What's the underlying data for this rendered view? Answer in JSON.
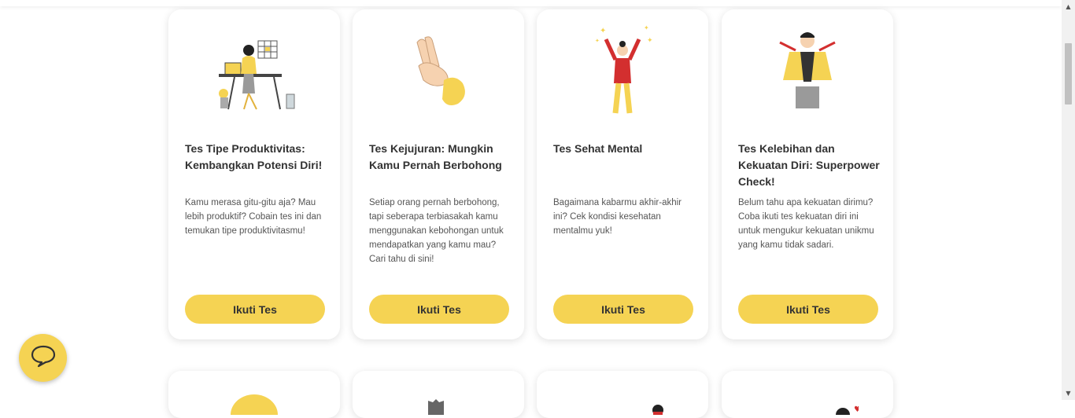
{
  "cards": [
    {
      "title": "Tes Tipe Produktivitas: Kembangkan Potensi Diri!",
      "description": "Kamu merasa gitu-gitu aja? Mau lebih produktif? Cobain tes ini dan temukan tipe produktivitasmu!",
      "button_label": "Ikuti Tes",
      "illustration": "person-at-desk-illustration"
    },
    {
      "title": "Tes Kejujuran: Mungkin Kamu Pernah Berbohong",
      "description": "Setiap orang pernah berbohong, tapi seberapa terbiasakah kamu menggunakan kebohongan untuk mendapatkan yang kamu mau? Cari tahu di sini!",
      "button_label": "Ikuti Tes",
      "illustration": "crossed-fingers-illustration"
    },
    {
      "title": "Tes Sehat Mental",
      "description": "Bagaimana kabarmu akhir-akhir ini? Cek kondisi kesehatan mentalmu yuk!",
      "button_label": "Ikuti Tes",
      "illustration": "cheering-person-illustration"
    },
    {
      "title": "Tes Kelebihan dan Kekuatan Diri: Superpower Check!",
      "description": "Belum tahu apa kekuatan dirimu? Coba ikuti tes kekuatan diri ini untuk mengukur kekuatan unikmu yang kamu tidak sadari.",
      "button_label": "Ikuti Tes",
      "illustration": "superhero-illustration"
    }
  ],
  "chat_button": {
    "icon": "chat-bubble-icon"
  },
  "colors": {
    "accent": "#f5d353",
    "text": "#333333",
    "muted": "#555555"
  }
}
